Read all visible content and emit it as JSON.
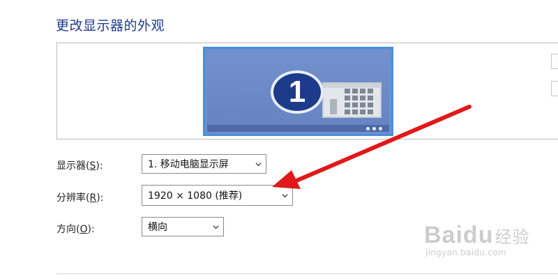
{
  "section_title": "更改显示器的外观",
  "monitor": {
    "number": "1"
  },
  "fields": {
    "display": {
      "label": "显示器",
      "accel_open": "(",
      "accel": "S",
      "accel_close": "):",
      "value": "1. 移动电脑显示屏"
    },
    "resolution": {
      "label": "分辨率",
      "accel_open": "(",
      "accel": "R",
      "accel_close": "):",
      "value": "1920 × 1080 (推荐)"
    },
    "orientation": {
      "label": "方向",
      "accel_open": "(",
      "accel": "O",
      "accel_close": "):",
      "value": "横向"
    }
  },
  "annotation": {
    "arrow_color": "#e0191b"
  },
  "watermark": {
    "logo_bai": "Bai",
    "logo_du": "du",
    "logo_jingyan": "经验",
    "url": "jingyan.baidu.com"
  },
  "colors": {
    "title": "#1e3a8a",
    "monitor_fill": "#6f8fce",
    "monitor_border": "#4a8fd8"
  },
  "icons": [
    "chevron-down-icon",
    "app-window-icon",
    "monitor-number-badge"
  ]
}
